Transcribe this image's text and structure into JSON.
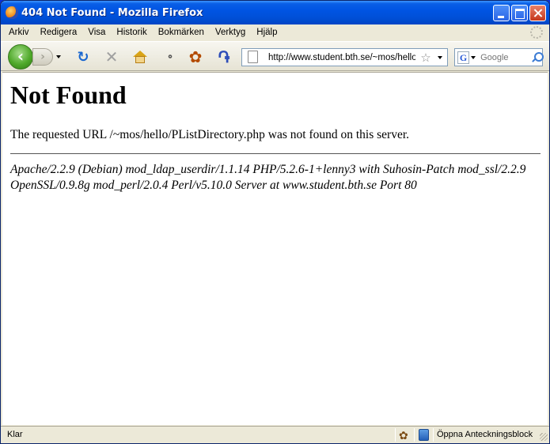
{
  "window": {
    "title": "404 Not Found - Mozilla Firefox"
  },
  "menu": {
    "items": [
      "Arkiv",
      "Redigera",
      "Visa",
      "Historik",
      "Bokmärken",
      "Verktyg",
      "Hjälp"
    ]
  },
  "toolbar": {
    "back_icon": "back-arrow-icon",
    "forward_icon": "forward-arrow-icon",
    "reload_icon": "reload-icon",
    "stop_icon": "stop-icon",
    "home_icon": "home-icon"
  },
  "urlbar": {
    "value": "http://www.student.bth.se/~mos/hello/PListDirectory.php"
  },
  "search": {
    "engine": "G",
    "placeholder": "Google"
  },
  "page": {
    "heading": "Not Found",
    "message": "The requested URL /~mos/hello/PListDirectory.php was not found on this server.",
    "server_signature": "Apache/2.2.9 (Debian) mod_ldap_userdir/1.1.14 PHP/5.2.6-1+lenny3 with Suhosin-Patch mod_ssl/2.2.9 OpenSSL/0.9.8g mod_perl/2.0.4 Perl/v5.10.0 Server at www.student.bth.se Port 80"
  },
  "status": {
    "text": "Klar",
    "notes_label": "Öppna Anteckningsblock"
  },
  "colors": {
    "titlebar": "#0054e3",
    "chrome": "#ece9d8",
    "page_bg": "#ffffff"
  }
}
